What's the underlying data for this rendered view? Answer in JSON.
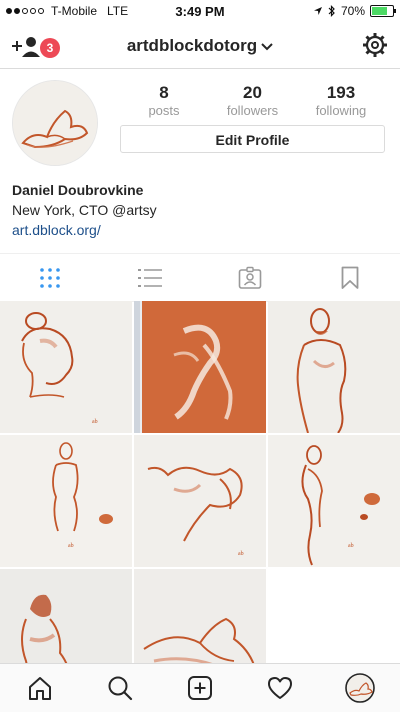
{
  "status_bar": {
    "carrier": "T-Mobile",
    "network": "LTE",
    "time": "3:49 PM",
    "battery": "70%",
    "battery_level": 0.7
  },
  "header": {
    "username": "artdblockdotorg",
    "notification_count": "3"
  },
  "profile": {
    "posts_count": "8",
    "posts_label": "posts",
    "followers_count": "20",
    "followers_label": "followers",
    "following_count": "193",
    "following_label": "following",
    "edit_button": "Edit Profile",
    "name": "Daniel Doubrovkine",
    "bio": "New York, CTO @artsy",
    "website": "art.dblock.org/"
  },
  "tabs": [
    "grid-icon",
    "list-icon",
    "tagged-icon",
    "saved-icon"
  ],
  "colors": {
    "accent_blue": "#3897f0",
    "badge_red": "#ed4956",
    "sanguine": "#c2562a",
    "link": "#1d4f8a"
  },
  "posts": [
    "portrait-head-sketch",
    "reclining-figure-orange-paper",
    "standing-bearded-man-sketch",
    "standing-nude-sketch",
    "reclining-figure-sketch",
    "side-standing-figure-sketch",
    "seated-figure-sketch",
    "reclining-legs-sketch"
  ],
  "bottom_nav": [
    "home-icon",
    "search-icon",
    "add-post-icon",
    "activity-heart-icon",
    "profile-avatar-icon"
  ]
}
